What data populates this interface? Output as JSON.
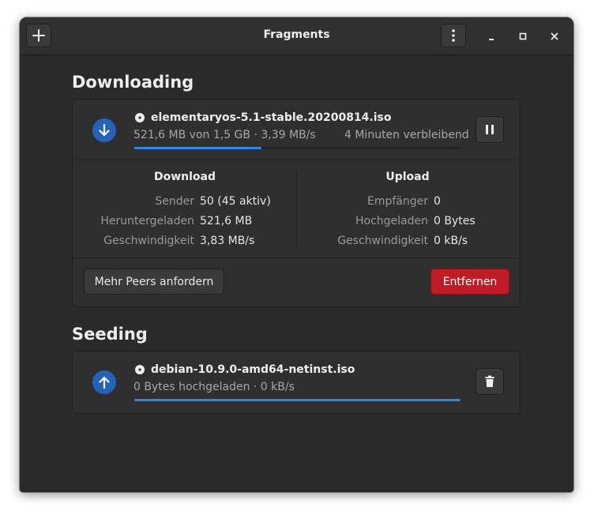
{
  "window": {
    "title": "Fragments"
  },
  "sections": {
    "downloading": "Downloading",
    "seeding": "Seeding"
  },
  "downloading_torrent": {
    "name": "elementaryos-5.1-stable.20200814.iso",
    "status_text": "521,6 MB von 1,5 GB · 3,39 MB/s",
    "eta": "4 Minuten verbleibend",
    "progress": 0.39,
    "download": {
      "heading": "Download",
      "rows": [
        {
          "label": "Sender",
          "value": "50 (45 aktiv)"
        },
        {
          "label": "Heruntergeladen",
          "value": "521,6 MB"
        },
        {
          "label": "Geschwindigkeit",
          "value": "3,83 MB/s"
        }
      ]
    },
    "upload": {
      "heading": "Upload",
      "rows": [
        {
          "label": "Empfänger",
          "value": "0"
        },
        {
          "label": "Hochgeladen",
          "value": "0 Bytes"
        },
        {
          "label": "Geschwindigkeit",
          "value": "0 kB/s"
        }
      ]
    },
    "more_peers_label": "Mehr Peers anfordern",
    "remove_label": "Entfernen"
  },
  "seeding_torrent": {
    "name": "debian-10.9.0-amd64-netinst.iso",
    "status_text": "0 Bytes hochgeladen · 0 kB/s",
    "progress": 1.0
  },
  "icons": {
    "add": "plus-icon",
    "menu": "vertical-dots-icon",
    "minimize": "minimize-icon",
    "maximize": "maximize-icon",
    "close": "close-icon",
    "download_status": "arrow-down-icon",
    "seed_status": "arrow-up-icon",
    "pause": "pause-icon",
    "delete": "trash-icon",
    "file": "disc-icon"
  },
  "colors": {
    "accent": "#3584e4",
    "status_circle": "#2563ba",
    "destructive": "#c01c28",
    "window_bg": "#2a2a2a",
    "card_bg": "#2f2f2f"
  }
}
